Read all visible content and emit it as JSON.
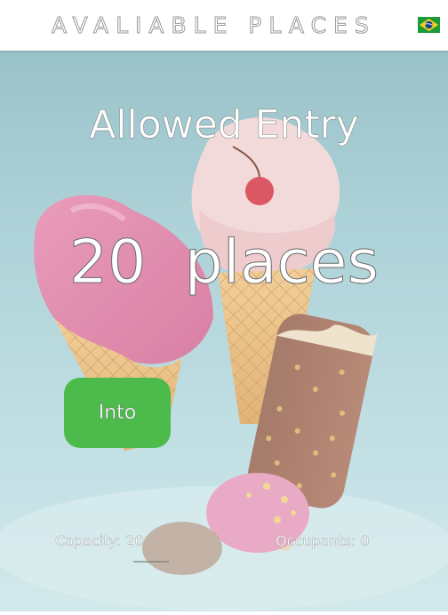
{
  "header": {
    "title": "AVALIABLE PLACES",
    "language_flag_icon": "brazil-flag-icon"
  },
  "main": {
    "title": "Allowed Entry",
    "places_text": "20  places",
    "into_button_label": "Into",
    "capacity_text": "Capacity: 20",
    "occupants_text": "Occupants: 0",
    "background_image": "ice-cream-illustration"
  },
  "colors": {
    "button_green": "#4cbb4c",
    "background_teal": "#a7cfd6"
  }
}
